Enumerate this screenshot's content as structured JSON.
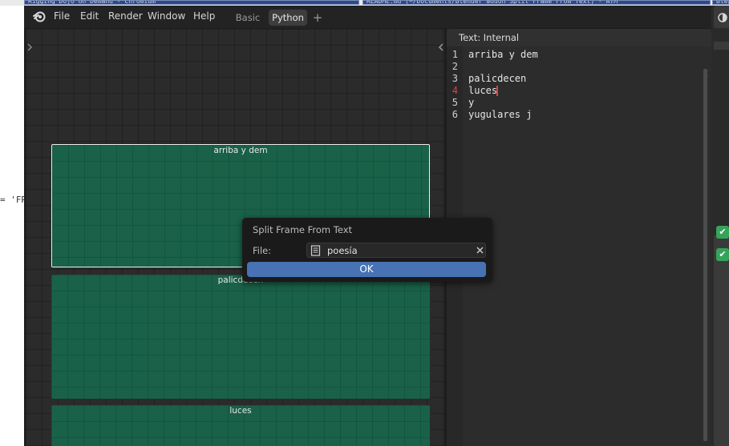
{
  "topstrip": {
    "tab1": "Rigging Dojo on Demand - Chromium",
    "tab2": "README.md (~/Documents/Blender addon Split Frame From Text) - ATM",
    "tab3": "Blender"
  },
  "left_snippet": "= 'FR",
  "menubar": {
    "items": [
      "File",
      "Edit",
      "Render",
      "Window",
      "Help"
    ],
    "tabs": [
      "Basic",
      "Python"
    ],
    "active_tab": "Python",
    "add_tab": "+"
  },
  "text_editor": {
    "header_title": "Text: Internal",
    "lines": [
      {
        "num": "1",
        "text": "arriba y dem"
      },
      {
        "num": "2",
        "text": ""
      },
      {
        "num": "3",
        "text": "palicdecen"
      },
      {
        "num": "4",
        "text": "luces"
      },
      {
        "num": "5",
        "text": "y"
      },
      {
        "num": "6",
        "text": "yugulares j"
      }
    ],
    "current_line": "4"
  },
  "frames": [
    "arriba y dem",
    "palicdecen",
    "luces"
  ],
  "popup": {
    "title": "Split Frame From Text",
    "file_label": "File:",
    "file_value": "poesía",
    "ok_label": "OK"
  },
  "colors": {
    "frame_green": "#196148",
    "accent_blue": "#4772b3",
    "current_line_red": "#e04040",
    "check_green": "#36a35a"
  },
  "icons": [
    "blender-logo-icon",
    "expand-arrow-icon",
    "collapse-arrow-icon",
    "text-file-icon",
    "clear-x-icon",
    "checkmark-icon",
    "viewport-shading-icon"
  ]
}
